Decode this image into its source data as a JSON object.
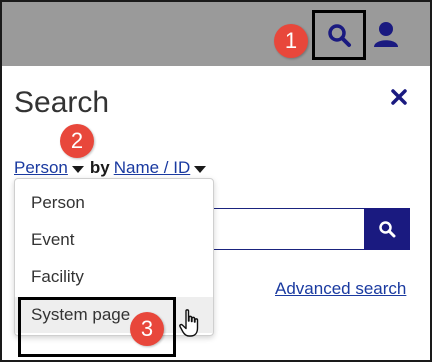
{
  "header": {
    "search_icon": "search-icon",
    "user_icon": "user-icon"
  },
  "annotations": {
    "step1": "1",
    "step2": "2",
    "step3": "3"
  },
  "panel": {
    "title": "Search",
    "close_icon": "close-icon"
  },
  "selector": {
    "entity_value": "Person",
    "by_label": "by",
    "field_value": "Name / ID"
  },
  "search": {
    "input_value": "",
    "button_icon": "search-icon"
  },
  "advanced_link": "Advanced search",
  "dropdown": {
    "options": [
      "Person",
      "Event",
      "Facility",
      "System page"
    ],
    "highlighted_index": 3
  },
  "colors": {
    "topbar": "#9a9a9a",
    "badge": "#e8473b",
    "link": "#1a3aa0",
    "button": "#1a1a80"
  }
}
